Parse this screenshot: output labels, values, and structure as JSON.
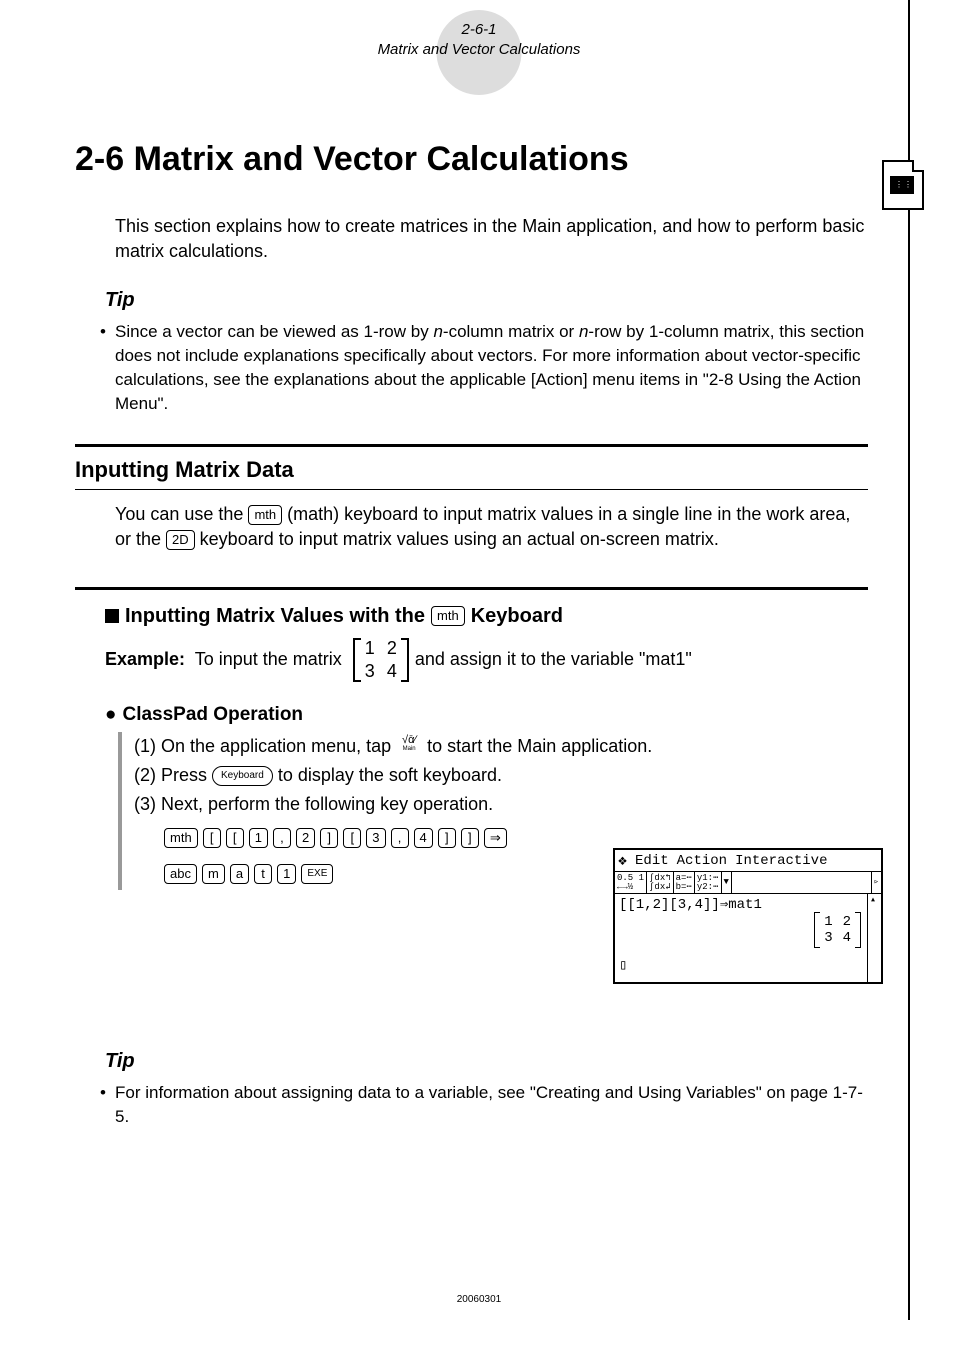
{
  "header": {
    "page_ref": "2-6-1",
    "subtitle": "Matrix and Vector Calculations"
  },
  "title": "2-6  Matrix and Vector Calculations",
  "intro": "This section explains how to create matrices in the Main application, and how to perform basic matrix calculations.",
  "tip1_heading": "Tip",
  "tip1_text": "Since a vector can be viewed as 1-row by n-column matrix or n-row by 1-column matrix, this section does not include explanations specifically about vectors. For more information about vector-specific calculations, see the explanations about the applicable [Action] menu items in \"2-8 Using the Action Menu\".",
  "section1_heading": "Inputting Matrix Data",
  "section1_text_a": "You can use the ",
  "section1_text_b": " (math) keyboard to input matrix values in a single line in the work area, or the ",
  "section1_text_c": " keyboard to input matrix values using an actual on-screen matrix.",
  "sub1_heading": "Inputting Matrix Values with the ",
  "sub1_heading_tail": " Keyboard",
  "example_label": "Example:",
  "example_pre": "  To input the matrix ",
  "example_post": " and assign it to the variable \"mat1\"",
  "matrix_vals": [
    "1",
    "2",
    "3",
    "4"
  ],
  "op_heading": "ClassPad Operation",
  "step1_a": "(1) On the application menu, tap ",
  "step1_b": " to start the Main application.",
  "step2_a": "(2) Press ",
  "step2_b": " to display the soft keyboard.",
  "step3": "(3) Next, perform the following key operation.",
  "keys": {
    "mth": "mth",
    "2D": "2D",
    "abc": "abc",
    "keyboard": "Keyboard",
    "lbr": "[",
    "rbr": "]",
    "comma": ",",
    "one": "1",
    "two": "2",
    "three": "3",
    "four": "4",
    "m": "m",
    "a": "a",
    "t": "t",
    "arrow": "⇒",
    "exe": "EXE"
  },
  "screenshot": {
    "menu": [
      "Edit",
      "Action",
      "Interactive"
    ],
    "input_line": "[[1,2][3,4]]⇒mat1",
    "cursor_line": "▯",
    "matrix": [
      "1",
      "2",
      "3",
      "4"
    ],
    "toolbar_cells": [
      "0.5 1\n←→½",
      "∫dx↰\n∫dx↲",
      "a=⋯\nb=⋯",
      "y1:⋯\ny2:⋯",
      "▼"
    ],
    "toolbar_right": "▹"
  },
  "tip2_heading": "Tip",
  "tip2_text": "For information about assigning data to a variable, see \"Creating and Using Variables\" on page 1-7-5.",
  "footer": "20060301"
}
